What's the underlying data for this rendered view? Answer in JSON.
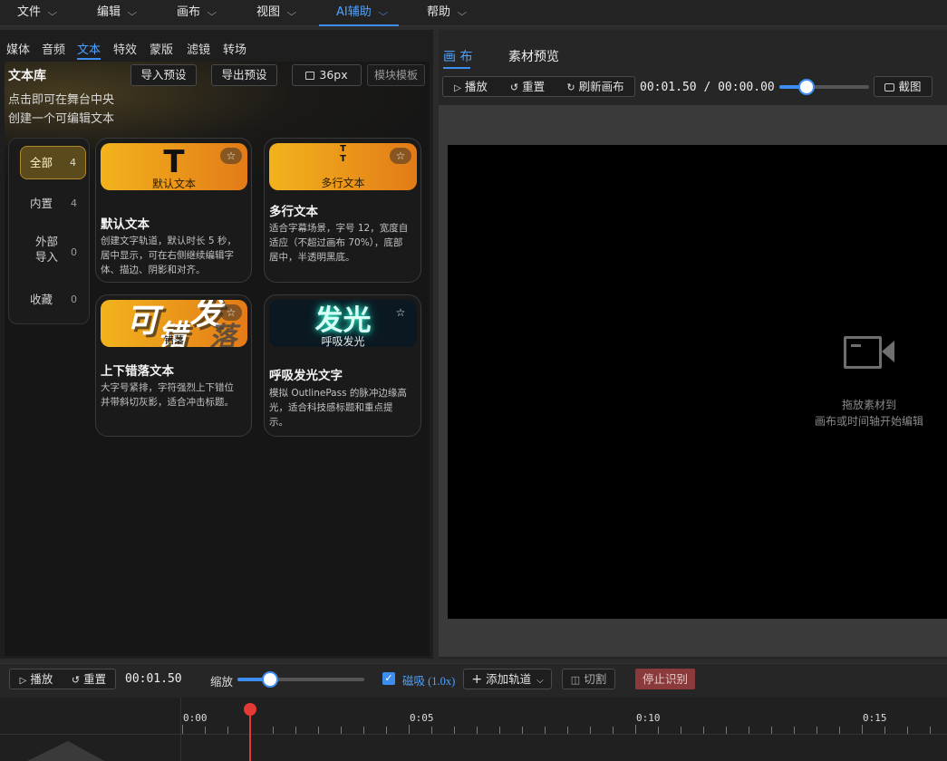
{
  "menu": [
    {
      "label": "文件"
    },
    {
      "label": "编辑"
    },
    {
      "label": "画布"
    },
    {
      "label": "视图"
    },
    {
      "label": "AI辅助"
    },
    {
      "label": "帮助"
    }
  ],
  "left": {
    "tabs": [
      {
        "label": "媒体"
      },
      {
        "label": "音频"
      },
      {
        "label": "文本"
      },
      {
        "label": "特效"
      },
      {
        "label": "蒙版"
      },
      {
        "label": "滤镜"
      },
      {
        "label": "转场"
      }
    ],
    "title": "文本库",
    "hint_line1": "点击即可在舞台中央",
    "hint_line2": "创建一个可编辑文本",
    "import_label": "导入预设",
    "export_label": "导出预设",
    "size_label": "36px",
    "template_label": "模块模板",
    "categories": [
      {
        "label": "全部",
        "count": "4"
      },
      {
        "label": "内置",
        "count": "4"
      },
      {
        "label_line1": "外部",
        "label_line2": "导入",
        "count": "0"
      },
      {
        "label": "收藏",
        "count": "0"
      }
    ],
    "cards": [
      {
        "thumb_glyph": "T",
        "thumb_label": "默认文本",
        "title": "默认文本",
        "desc": [
          "创建文字轨道，默认时长 5 秒，",
          "居中显示，可在右侧继续编辑字",
          "体、描边、阴影和对齐。"
        ]
      },
      {
        "thumb_glyph_top": "T",
        "thumb_glyph_bottom": "T",
        "thumb_label": "多行文本",
        "title": "多行文本",
        "desc": [
          "适合字幕场景，字号 12，宽度自",
          "适应（不超过画布 70%），底部",
          "居中，半透明黑底。"
        ]
      },
      {
        "thumb_char1": "可",
        "thumb_char2": "错",
        "thumb_char3": "落",
        "thumb_char4": "发",
        "thumb_char5": "错落",
        "title": "上下错落文本",
        "desc": [
          "大字号紧排，字符强烈上下错位",
          "并带斜切灰影，适合冲击标题。"
        ]
      },
      {
        "thumb_glyph": "发光",
        "thumb_label": "呼吸发光",
        "title": "呼吸发光文字",
        "desc": [
          "模拟 OutlinePass 的脉冲边缘高",
          "光，适合科技感标题和重点提",
          "示。"
        ]
      }
    ],
    "star_glyph": "☆"
  },
  "right": {
    "tab_canvas": "画 布",
    "tab_preview": "素材预览",
    "play_label": "播放",
    "reset_label": "重置",
    "refresh_label": "刷新画布",
    "time_current": "00:01.50",
    "time_sep": "/",
    "time_total": "00:00.00",
    "progress": 0.3,
    "screenshot_label": "截图",
    "empty_line1": "拖放素材到",
    "empty_line2": "画布或时间轴开始编辑"
  },
  "bottom": {
    "play_label": "播放",
    "reset_label": "重置",
    "time": "00:01.50",
    "zoom_label": "缩放",
    "zoom_value": 0.26,
    "magnet_checked": true,
    "magnet_label": "磁吸 (1.0x)",
    "add_track_label": "添加轨道",
    "cut_label": "切割",
    "stop_label": "停止识别"
  },
  "timeline": {
    "ticks": [
      {
        "label": "0:00"
      },
      {
        "label": "0:05"
      },
      {
        "label": "0:10"
      },
      {
        "label": "0:15"
      }
    ]
  },
  "colors": {
    "accent": "#3d8ef0",
    "stop_bg": "#8a3a3a",
    "playhead": "#e53935",
    "gold_start": "#f2b31c",
    "gold_end": "#e37b18"
  }
}
